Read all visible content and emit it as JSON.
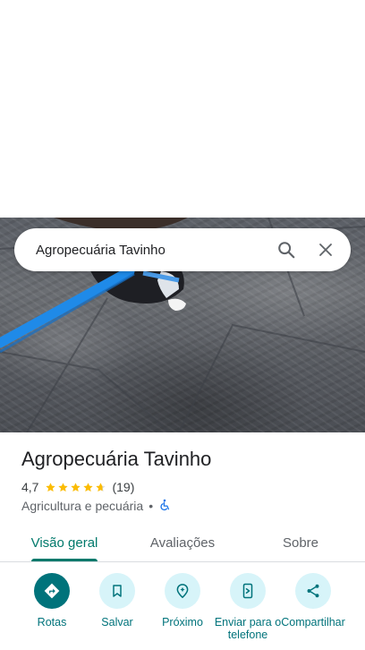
{
  "search": {
    "query": "Agropecuária Tavinho",
    "search_icon": "search-icon",
    "close_icon": "close-icon"
  },
  "photo": {
    "icon": "place-photo"
  },
  "place": {
    "name": "Agropecuária Tavinho",
    "rating": "4,7",
    "rating_value": 4.7,
    "stars_max": 5,
    "review_count": "(19)",
    "category": "Agricultura e pecuária",
    "separator": "•",
    "accessibility_icon": "wheelchair-icon"
  },
  "tabs": [
    {
      "label": "Visão geral",
      "active": true
    },
    {
      "label": "Avaliações",
      "active": false
    },
    {
      "label": "Sobre",
      "active": false
    }
  ],
  "actions": [
    {
      "label": "Rotas",
      "icon": "directions-icon"
    },
    {
      "label": "Salvar",
      "icon": "bookmark-icon"
    },
    {
      "label": "Próximo",
      "icon": "nearby-icon"
    },
    {
      "label": "Enviar para o telefone",
      "icon": "send-to-phone-icon"
    },
    {
      "label": "Compartilhar",
      "icon": "share-icon"
    }
  ],
  "colors": {
    "accent": "#00737b",
    "tab_active": "#00796b",
    "action_bg": "#d7f4f9",
    "star": "#fbbc04"
  }
}
